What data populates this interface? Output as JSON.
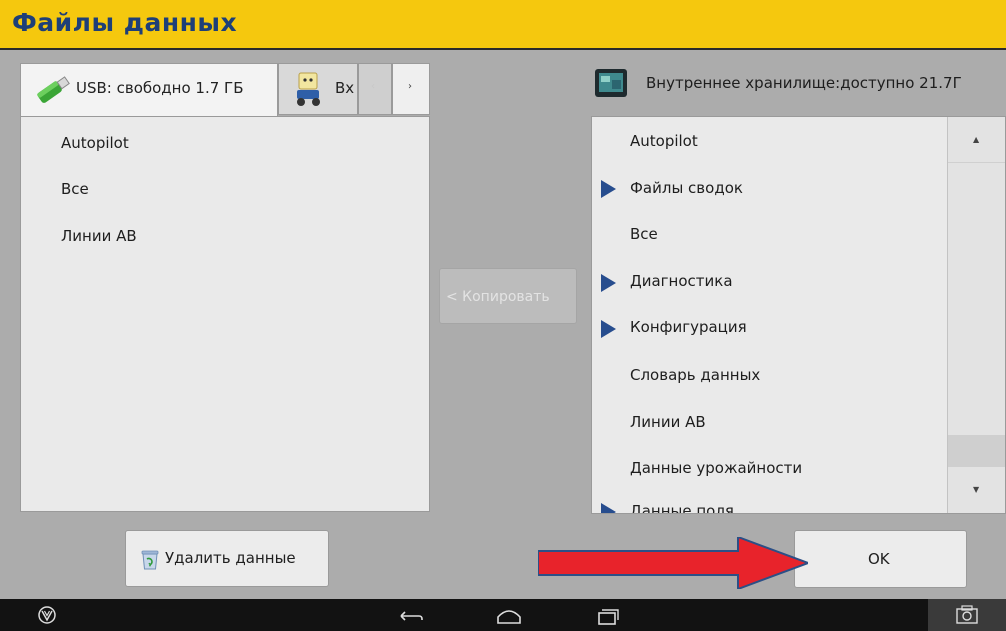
{
  "window": {
    "title": "Файлы данных"
  },
  "source_tabs": {
    "usb_label": "USB: свободно 1.7 ГБ",
    "second_label": "Вх"
  },
  "left_list": [
    "Autopilot",
    "Все",
    "Линии АВ"
  ],
  "copy_button": "< Копировать",
  "storage": {
    "label": "Внутреннее хранилище:доступно 21.7Г"
  },
  "right_list": [
    {
      "label": "Autopilot",
      "expandable": false
    },
    {
      "label": "Файлы сводок",
      "expandable": true
    },
    {
      "label": "Все",
      "expandable": false
    },
    {
      "label": "Диагностика",
      "expandable": true
    },
    {
      "label": "Конфигурация",
      "expandable": true
    },
    {
      "label": "Словарь данных",
      "expandable": false
    },
    {
      "label": "Линии АВ",
      "expandable": false
    },
    {
      "label": "Данные урожайности",
      "expandable": false
    },
    {
      "label": "Данные поля",
      "expandable": true
    }
  ],
  "buttons": {
    "delete": "Удалить данные",
    "ok": "OK"
  },
  "colors": {
    "title_bar": "#f5c80e",
    "title_text": "#1e3f78",
    "arrow": "#e8232b",
    "expand_marker": "#274d8e"
  },
  "icons": [
    "usb-drive-icon",
    "vehicle-icon",
    "display-storage-icon",
    "recycle-bin-icon",
    "brand-logo-icon",
    "back-icon",
    "home-icon",
    "recent-apps-icon",
    "screenshot-icon"
  ]
}
